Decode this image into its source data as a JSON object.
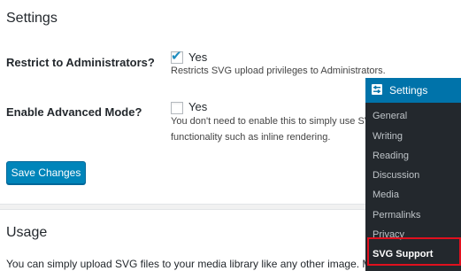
{
  "page": {
    "settings_heading": "Settings",
    "usage_heading": "Usage",
    "usage_text": "You can simply upload SVG files to your media library like any other image. Mak"
  },
  "fields": {
    "restrict": {
      "label": "Restrict to Administrators?",
      "checked": true,
      "option": "Yes",
      "description": "Restricts SVG upload privileges to Administrators."
    },
    "advanced": {
      "label": "Enable Advanced Mode?",
      "checked": false,
      "option": "Yes",
      "description_line1": "You don't need to enable this to simply use SVG",
      "description_line2": "functionality such as inline rendering."
    }
  },
  "buttons": {
    "save_label": "Save Changes"
  },
  "submenu": {
    "title": "Settings",
    "items": [
      "General",
      "Writing",
      "Reading",
      "Discussion",
      "Media",
      "Permalinks",
      "Privacy",
      "SVG Support"
    ],
    "active_item": "SVG Support"
  },
  "colors": {
    "primary": "#0085ba",
    "menu_bg": "#23282d",
    "menu_head": "#0073aa",
    "highlight": "#e0101e"
  }
}
